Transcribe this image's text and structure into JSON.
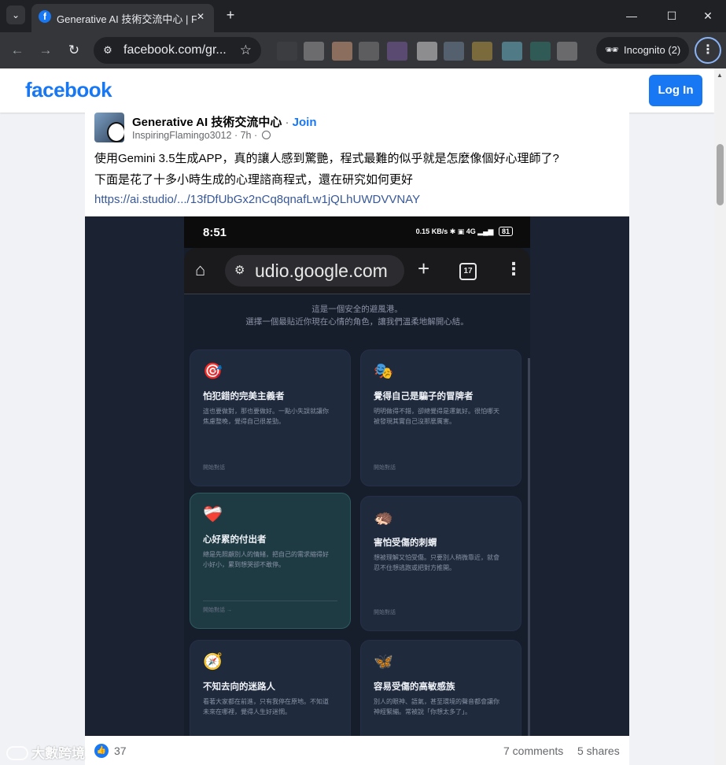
{
  "browser": {
    "tab_title": "Generative AI 技術交流中心 | Fa",
    "tab_favicon": "f",
    "url": "facebook.com/gr...",
    "incognito_label": "Incognito (2)"
  },
  "fb": {
    "logo": "facebook",
    "login_label": "Log In"
  },
  "post": {
    "group_name": "Generative AI 技術交流中心",
    "separator": " · ",
    "join_label": "Join",
    "author_time": "InspiringFlamingo3012 · 7h ·",
    "text_line1": "使用Gemini 3.5生成APP，真的讓人感到驚艷，程式最難的似乎就是怎麼像個好心理師了?",
    "text_line2": "下面是花了十多小時生成的心理諮商程式，還在研究如何更好",
    "link": "https://ai.studio/.../13fDfUbGx2nCq8qnafLw1jQLhUWDVVNAY"
  },
  "phone": {
    "time": "8:51",
    "status_icons": "0.15 KB/s ✱ ▣ 4G ▂▄▆",
    "battery": "81",
    "url_text": "udio.google.com",
    "tab_count": "17",
    "intro_line1": "這是一個安全的避風港。",
    "intro_line2": "選擇一個最貼近你現在心情的角色，讓我們溫柔地解開心結。",
    "cards": [
      {
        "emoji": "🎯",
        "title": "怕犯錯的完美主義者",
        "desc1": "這也要做對，那也要做好。一點小失誤就讓你",
        "desc2": "焦慮整晚，覺得自己很差勁。",
        "foot": "開始對話"
      },
      {
        "emoji": "🎭",
        "title": "覺得自己是騙子的冒牌者",
        "desc1": "明明做得不錯，卻總覺得是運氣好。很怕哪天",
        "desc2": "被發現其實自己沒那麼厲害。",
        "foot": "開始對話"
      },
      {
        "emoji": "❤️‍🩹",
        "title": "心好累的付出者",
        "desc1": "總是先照顧別人的情緒，把自己的需求縮得好",
        "desc2": "小好小，累到想哭卻不敢停。",
        "foot": "開始對話 →"
      },
      {
        "emoji": "🦔",
        "title": "害怕受傷的刺蝟",
        "desc1": "想被理解又怕受傷。只要別人稍微靠近，就會",
        "desc2": "忍不住想逃跑或把對方推開。",
        "foot": "開始對話"
      },
      {
        "emoji": "🧭",
        "title": "不知去向的迷路人",
        "desc1": "看著大家都在前進，只有我停在原地。不知道",
        "desc2": "未來在哪裡，覺得人生好迷惘。",
        "foot": ""
      },
      {
        "emoji": "🦋",
        "title": "容易受傷的高敏感族",
        "desc1": "別人的眼神、語氣，甚至環境的聲音都會讓你",
        "desc2": "神經緊繃。常被說「你想太多了」。",
        "foot": ""
      }
    ]
  },
  "reactions": {
    "like_count": "37",
    "comments": "7 comments",
    "shares": "5 shares"
  },
  "watermark": "大數跨境",
  "colors": {
    "brand": "#1877f2",
    "chrome_dark": "#202124",
    "chrome_toolbar": "#35363a",
    "app_bg": "#1b2333",
    "card_bg": "#1f2a3d",
    "card_active": "#1e3b43"
  }
}
